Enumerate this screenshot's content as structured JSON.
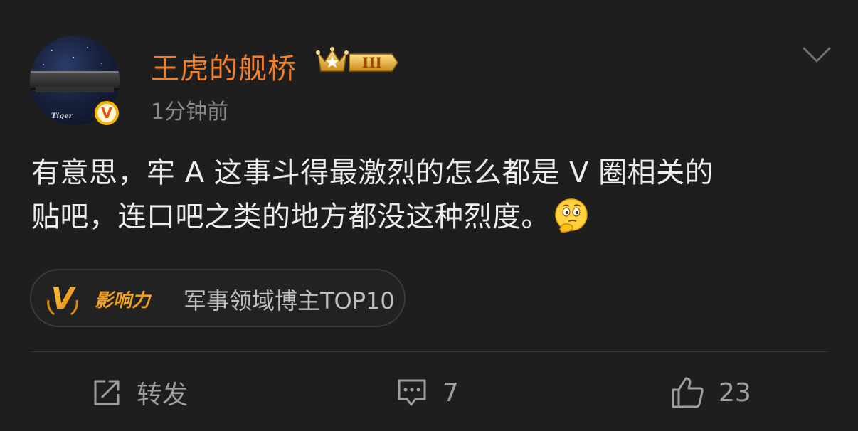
{
  "post": {
    "author": {
      "name": "王虎的舰桥",
      "avatar_tag": "Tiger",
      "verified_mark": "V",
      "level_badge": "III",
      "level_badge_icon": "crown-icon",
      "name_color": "#f07e2a"
    },
    "time": "1分钟前",
    "menu_icon": "chevron-down-icon",
    "content": {
      "line1": "有意思，牢 A 这事斗得最激烈的怎么都是 V 圈相关的",
      "line2": "贴吧，连口吧之类的地方都没这种烈度。",
      "emoji": "thinking-face-emoji"
    },
    "influence": {
      "logo_letter": "V",
      "logo_text": "影响力",
      "label": "军事领域博主TOP10",
      "accent": "#f0a020"
    }
  },
  "actions": {
    "repost": {
      "label": "转发",
      "icon": "share-icon"
    },
    "comment": {
      "count": "7",
      "icon": "comment-icon"
    },
    "like": {
      "count": "23",
      "icon": "thumbs-up-icon"
    }
  },
  "colors": {
    "background": "#1e1e1e",
    "text": "#ececec",
    "muted": "#8a8a8a",
    "verified": "#f7b500"
  }
}
